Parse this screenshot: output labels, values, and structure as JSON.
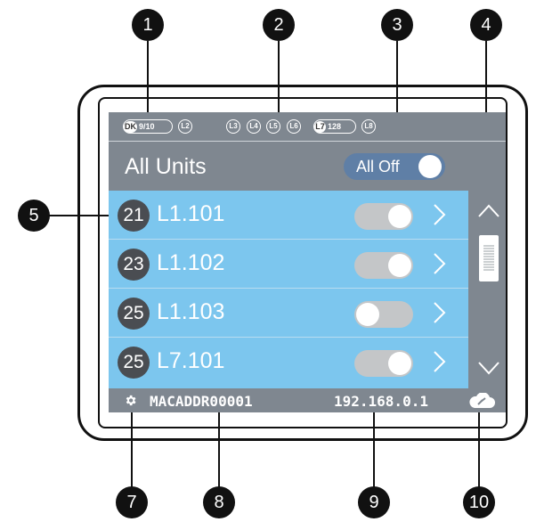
{
  "callouts": {
    "c1": "1",
    "c2": "2",
    "c3": "3",
    "c4": "4",
    "c5": "5",
    "c7": "7",
    "c8": "8",
    "c9": "9",
    "c10": "10"
  },
  "level_bar": {
    "dk_badge": "DK",
    "dk_value": "9/10",
    "levels": [
      "L2",
      "L3",
      "L4",
      "L5",
      "L6",
      "L8"
    ],
    "l7_badge": "L7",
    "l7_value": "128"
  },
  "header": {
    "title": "All Units",
    "all_off_label": "All Off",
    "all_off_state": "on"
  },
  "units": [
    {
      "badge": "21",
      "name": "L1.101",
      "toggle": "on"
    },
    {
      "badge": "23",
      "name": "L1.102",
      "toggle": "on"
    },
    {
      "badge": "25",
      "name": "L1.103",
      "toggle": "off"
    },
    {
      "badge": "25",
      "name": "L7.101",
      "toggle": "on"
    }
  ],
  "footer": {
    "mac": "MACADDR00001",
    "ip": "192.168.0.1"
  },
  "icons": {
    "settings": "gear-icon",
    "link": "cloud-link-icon",
    "scroll_up": "chevron-up-icon",
    "scroll_down": "chevron-down-icon",
    "row_next": "chevron-right-icon"
  },
  "colors": {
    "panel_gray": "#7f8790",
    "list_blue": "#7cc6ee",
    "badge_dark": "#4a4d52",
    "toggle_track": "#c4c6c8",
    "all_off_track": "#5f7fa6"
  }
}
